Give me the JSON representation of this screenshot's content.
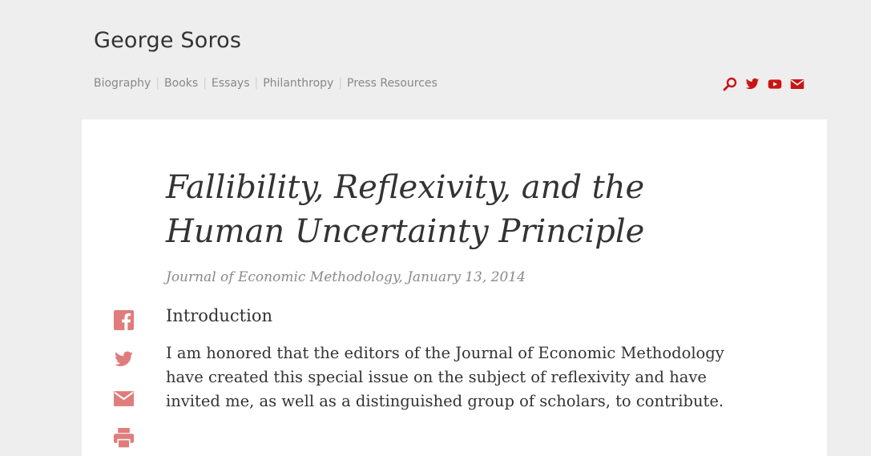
{
  "site": {
    "title": "George Soros"
  },
  "nav": {
    "items": [
      {
        "label": "Biography"
      },
      {
        "label": "Books"
      },
      {
        "label": "Essays"
      },
      {
        "label": "Philanthropy"
      },
      {
        "label": "Press Resources"
      }
    ]
  },
  "header_icons": [
    "search-icon",
    "twitter-icon",
    "youtube-icon",
    "email-icon"
  ],
  "share_icons": [
    "facebook-icon",
    "twitter-icon",
    "email-icon",
    "print-icon"
  ],
  "article": {
    "title": "Fallibility, Reflexivity, and the Human Uncertainty Principle",
    "byline": "Journal of Economic Methodology, January 13, 2014",
    "section_heading": "Introduction",
    "paragraph": "I am honored that the editors of the Journal of Economic Methodology have created this special issue on the subject of reflexivity and have invited me, as well as a distinguished group of scholars, to contribute."
  },
  "colors": {
    "accent": "#c81414",
    "share_icon": "#e07c7c",
    "page_bg": "#eeeeee",
    "card_bg": "#ffffff"
  }
}
